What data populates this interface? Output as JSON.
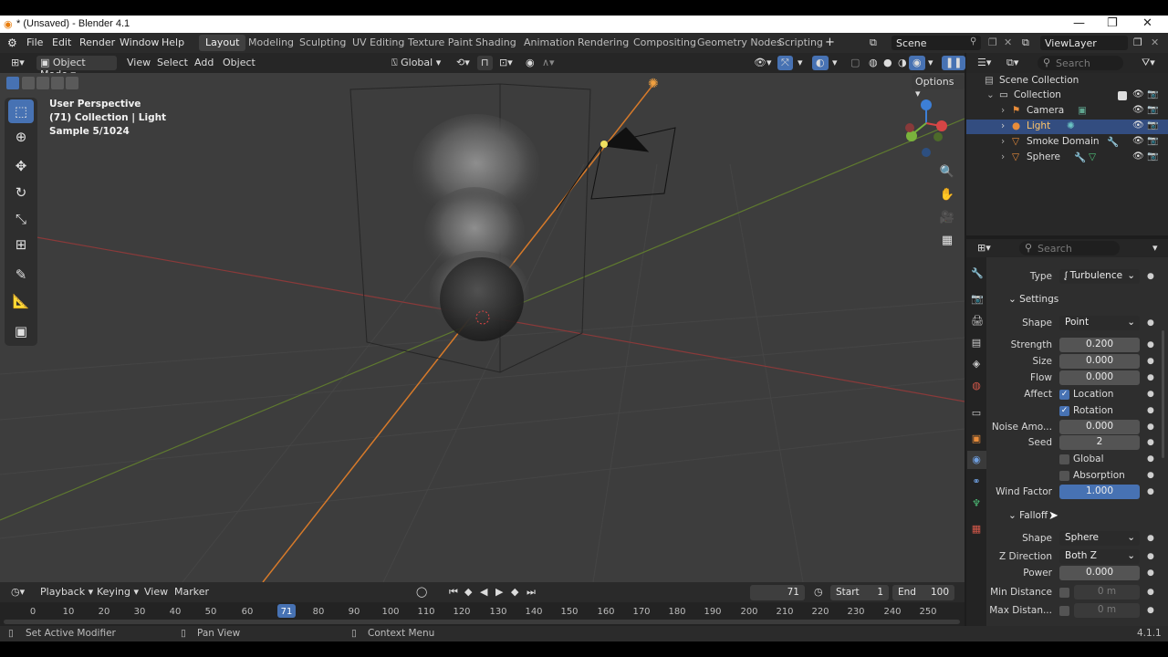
{
  "window": {
    "title": "* (Unsaved) - Blender 4.1",
    "minimize": "—",
    "maximize": "❐",
    "close": "✕"
  },
  "menubar": {
    "items": [
      "File",
      "Edit",
      "Render",
      "Window",
      "Help"
    ],
    "workspaces": [
      "Layout",
      "Modeling",
      "Sculpting",
      "UV Editing",
      "Texture Paint",
      "Shading",
      "Animation",
      "Rendering",
      "Compositing",
      "Geometry Nodes",
      "Scripting"
    ],
    "active_workspace": "Layout",
    "add_workspace": "+",
    "scene": "Scene",
    "view_layer": "ViewLayer"
  },
  "viewport_header": {
    "mode": "Object Mode",
    "menus": [
      "View",
      "Select",
      "Add",
      "Object"
    ],
    "transform_orientation": "Global",
    "options": "Options"
  },
  "viewport": {
    "view_name": "User Perspective",
    "collection_info": "(71) Collection | Light",
    "sample": "Sample 5/1024"
  },
  "outliner": {
    "search_placeholder": "Search",
    "scene_collection": "Scene Collection",
    "collection": "Collection",
    "items": [
      {
        "name": "Camera",
        "selected": false
      },
      {
        "name": "Light",
        "selected": true
      },
      {
        "name": "Smoke Domain",
        "selected": false
      },
      {
        "name": "Sphere",
        "selected": false
      }
    ]
  },
  "properties": {
    "search_placeholder": "Search",
    "type_label": "Type",
    "type_value": "Turbulence",
    "settings_section": "Settings",
    "shape_label": "Shape",
    "shape_value": "Point",
    "strength_label": "Strength",
    "strength_value": "0.200",
    "size_label": "Size",
    "size_value": "0.000",
    "flow_label": "Flow",
    "flow_value": "0.000",
    "affect_label": "Affect",
    "affect_location": "Location",
    "affect_rotation": "Rotation",
    "noise_label": "Noise Amo...",
    "noise_value": "0.000",
    "seed_label": "Seed",
    "seed_value": "2",
    "global_label": "Global",
    "absorption_label": "Absorption",
    "wind_label": "Wind Factor",
    "wind_value": "1.000",
    "falloff_section": "Falloff",
    "falloff_shape_label": "Shape",
    "falloff_shape_value": "Sphere",
    "zdir_label": "Z Direction",
    "zdir_value": "Both Z",
    "power_label": "Power",
    "power_value": "0.000",
    "min_dist_label": "Min Distance",
    "min_dist_value": "0 m",
    "max_dist_label": "Max Distan...",
    "max_dist_value": "0 m"
  },
  "timeline": {
    "menus": [
      "Playback",
      "Keying",
      "View",
      "Marker"
    ],
    "current_frame": "71",
    "start_label": "Start",
    "start_value": "1",
    "end_label": "End",
    "end_value": "100",
    "ticks": [
      "0",
      "10",
      "20",
      "30",
      "40",
      "50",
      "60",
      "71",
      "80",
      "90",
      "100",
      "110",
      "120",
      "130",
      "140",
      "150",
      "160",
      "170",
      "180",
      "190",
      "200",
      "210",
      "220",
      "230",
      "240",
      "250"
    ]
  },
  "statusbar": {
    "left": "Set Active Modifier",
    "middle": "Pan View",
    "right": "Context Menu",
    "version": "4.1.1"
  },
  "colors": {
    "accent": "#4772b3",
    "selection": "#334d80",
    "viewport_bg": "#3d3d3d"
  }
}
